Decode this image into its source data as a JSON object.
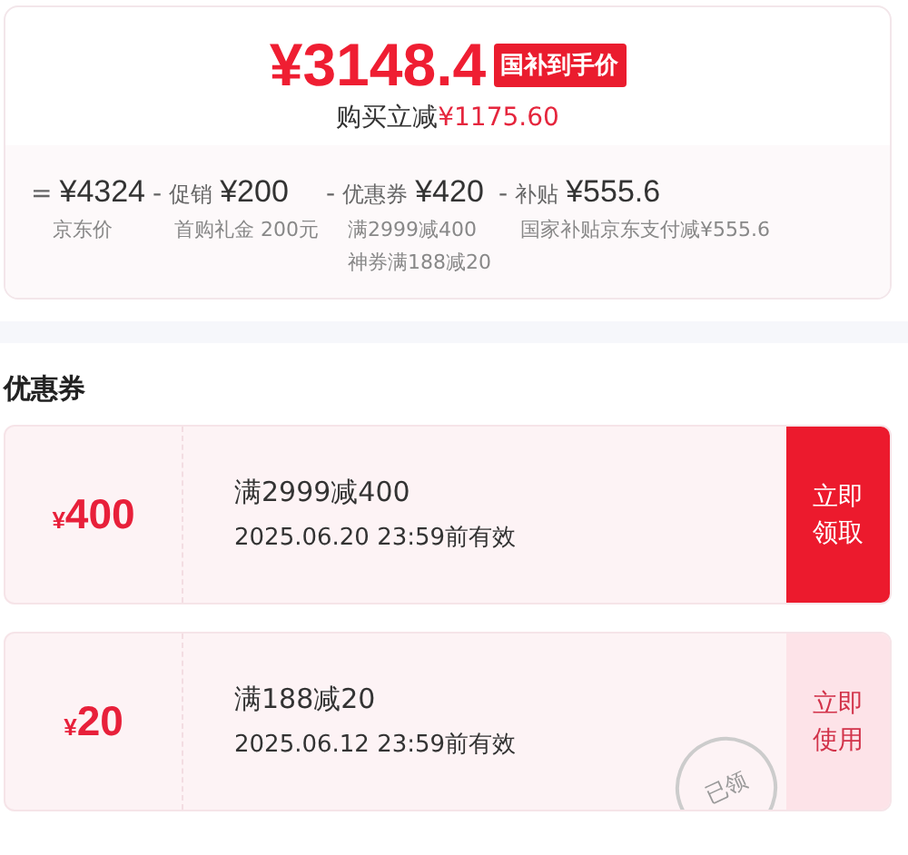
{
  "price_card": {
    "price": "¥3148.4",
    "badge": "国补到手价",
    "saving_label": "购买立减",
    "saving_amount": "¥1175.60",
    "breakdown": [
      {
        "op": "=",
        "amount": "¥4324",
        "notes": [
          "京东价"
        ]
      },
      {
        "op": "-",
        "label": "促销",
        "amount": "¥200",
        "notes": [
          "首购礼金 200元"
        ]
      },
      {
        "op": "-",
        "label": "优惠券",
        "amount": "¥420",
        "notes": [
          "满2999减400",
          "神券满188减20"
        ]
      },
      {
        "op": "-",
        "label": "补贴",
        "amount": "¥555.6",
        "notes": [
          "国家补贴京东支付减¥555.6"
        ]
      }
    ]
  },
  "coupons_title": "优惠券",
  "coupons": [
    {
      "currency": "¥",
      "value": "400",
      "condition": "满2999减400",
      "validity": "2025.06.20 23:59前有效",
      "action": "立即领取",
      "claimed": false
    },
    {
      "currency": "¥",
      "value": "20",
      "condition": "满188减20",
      "validity": "2025.06.12 23:59前有效",
      "action": "立即使用",
      "claimed": true,
      "stamp": "已领"
    }
  ]
}
